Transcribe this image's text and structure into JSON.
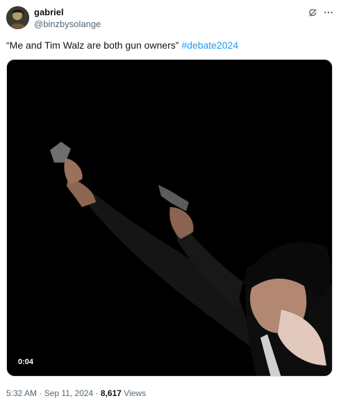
{
  "author": {
    "display_name": "gabriel",
    "handle": "@binzbysolange",
    "avatar_icon": "user-avatar"
  },
  "actions": {
    "grok_icon": "grok-icon",
    "more_icon": "more-icon"
  },
  "tweet": {
    "text": "“Me and Tim Walz are both gun owners” ",
    "hashtag": "#debate2024"
  },
  "media": {
    "type": "video",
    "duration": "0:04"
  },
  "meta": {
    "time": "5:32 AM",
    "separator": "·",
    "date": "Sep 11, 2024",
    "views_count": "8,617",
    "views_label": "Views"
  },
  "colors": {
    "link": "#1d9bf0",
    "secondary_text": "#536471",
    "primary_text": "#0f1419"
  }
}
